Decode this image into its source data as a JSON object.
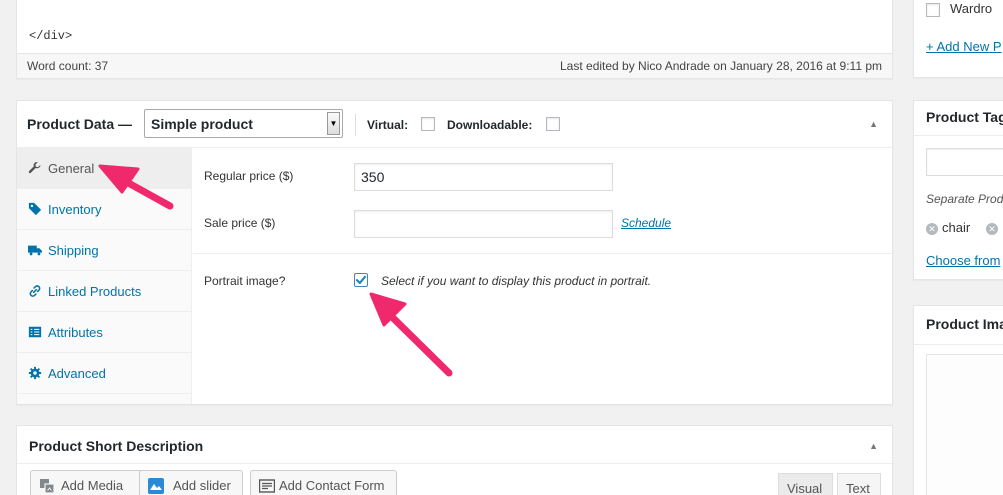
{
  "editor": {
    "closing_tag": "</div>",
    "word_count": "Word count: 37",
    "last_edited": "Last edited by Nico Andrade on January 28, 2016 at 9:11 pm"
  },
  "product_data": {
    "title": "Product Data —",
    "product_type": "Simple product",
    "virtual_label": "Virtual:",
    "downloadable_label": "Downloadable:",
    "tabs": [
      {
        "label": "General",
        "icon": "wrench-icon",
        "active": true
      },
      {
        "label": "Inventory",
        "icon": "tag-icon"
      },
      {
        "label": "Shipping",
        "icon": "truck-icon"
      },
      {
        "label": "Linked Products",
        "icon": "link-icon"
      },
      {
        "label": "Attributes",
        "icon": "list-icon"
      },
      {
        "label": "Advanced",
        "icon": "gear-icon"
      }
    ],
    "regular_price_label": "Regular price ($)",
    "regular_price_value": "350",
    "sale_price_label": "Sale price ($)",
    "sale_price_value": "",
    "schedule_link": "Schedule",
    "portrait_label": "Portrait image?",
    "portrait_checked": true,
    "portrait_description": "Select if you want to display this product in portrait."
  },
  "short_description": {
    "title": "Product Short Description",
    "buttons": {
      "add_media": "Add Media",
      "add_slider": "Add slider",
      "add_contact_form": "Add Contact Form"
    },
    "tab_visual": "Visual",
    "tab_text": "Text"
  },
  "sidebar": {
    "category_label": "Wardro",
    "add_new_link": "+ Add New P",
    "tags_title": "Product Tag",
    "tags_help": "Separate Prod",
    "tags": [
      "chair",
      ""
    ],
    "choose_link": "Choose from",
    "image_title": "Product Ima"
  },
  "colors": {
    "link": "#0073aa",
    "annotation_arrow": "#f0286c",
    "checkbox_check": "#1e8cbe"
  }
}
